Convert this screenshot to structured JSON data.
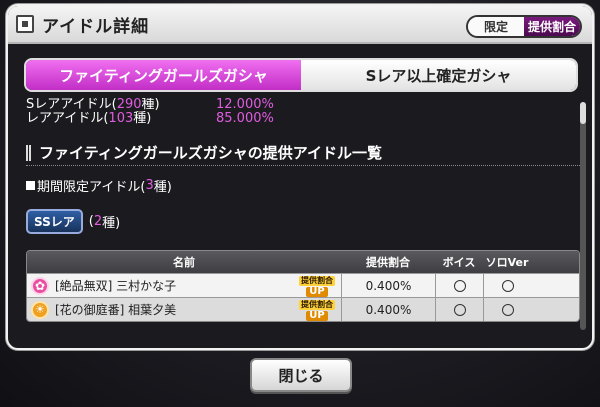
{
  "header": {
    "title": "アイドル詳細",
    "seg_limited": "限定",
    "seg_rates": "提供割合"
  },
  "tabs": [
    {
      "label": "ファイティングガールズガシャ",
      "active": true
    },
    {
      "label": "Sレア以上確定ガシャ",
      "active": false
    }
  ],
  "rates": [
    {
      "prefix": "Sレアアイドル(",
      "count": "290",
      "suffix": "種)",
      "percent": "12.000%"
    },
    {
      "prefix": "レアアイドル(",
      "count": "103",
      "suffix": "種)",
      "percent": "85.000%"
    }
  ],
  "section": {
    "title": "ファイティングガールズガシャの提供アイドル一覧"
  },
  "limited": {
    "prefix": "期間限定アイドル(",
    "count": "3",
    "suffix": "種)"
  },
  "ssr": {
    "badge": "SSレア",
    "prefix": "(",
    "count": "2",
    "suffix": "種)"
  },
  "table": {
    "headers": {
      "name": "名前",
      "rate": "提供割合",
      "voice": "ボイス",
      "solo": "ソロVer"
    },
    "rows": [
      {
        "type_icon": "cute-type-icon",
        "name": "[絶品無双] 三村かな子",
        "badge_top": "提供割合",
        "badge_bottom": "UP",
        "rate": "0.400%"
      },
      {
        "type_icon": "passion-type-icon",
        "name": "[花の御庭番] 相葉夕美",
        "badge_top": "提供割合",
        "badge_bottom": "UP",
        "rate": "0.400%"
      }
    ]
  },
  "close_label": "閉じる",
  "colors": {
    "accent_pink": "#c22ec6",
    "highlight_pink": "#e05ce0",
    "seg_active": "#5a0f5e"
  }
}
